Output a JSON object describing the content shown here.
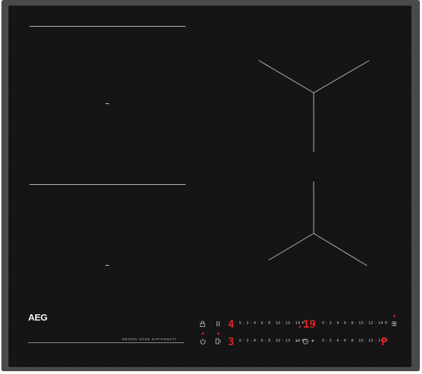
{
  "brand": {
    "logo": "AEG",
    "tagline": "BRIDGE ZONE SAPHIRMATT"
  },
  "controls": {
    "row1_left": {
      "lock_icon": "lock-icon",
      "pause_icon": "pause-icon",
      "level": "4",
      "scale": "0 · 2 · 4 · 6 · 8 · 10 · 12 · 14 P"
    },
    "row1_right": {
      "timer_display": ".19",
      "scale": "0 · 2 · 4 · 6 · 8 · 10 · 12 · 14 P",
      "bridge_icon": "bridge-icon"
    },
    "row2_left": {
      "power_icon": "power-icon",
      "hob2hood_icon": "hob2hood-icon",
      "level": "3",
      "scale": "0 · 2 · 4 · 6 · 8 · 10 · 12 · 14 P"
    },
    "row2_right": {
      "timer_minus": "−",
      "timer_icon": "timer-icon",
      "timer_plus": "+",
      "scale": "0 · 2 · 4 · 6 · 8 · 10 · 12 · 14 P",
      "level": "P"
    }
  },
  "colors": {
    "glass": "#141415",
    "frame": "#4a4a4a",
    "display_red": "#e22121",
    "markings": "#bcbcbc"
  }
}
